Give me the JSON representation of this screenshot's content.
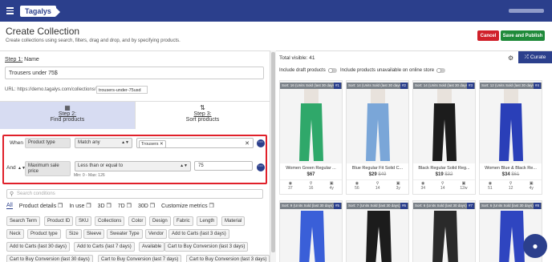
{
  "brand": {
    "logo_text": "Tagalys",
    "primary": "#2b3f8c",
    "danger": "#d0202a",
    "success": "#1f8a3a"
  },
  "header": {
    "title": "Create Collection",
    "subtitle": "Create collections using search, filters, drag and drop, and by specifying products.",
    "cancel_label": "Cancel",
    "save_label": "Save and Publish"
  },
  "step1": {
    "label_prefix": "Step 1:",
    "label": " Name",
    "name_value": "Trousers under 75$",
    "url_label": "URL: https://demo.tagalys.com/collections/",
    "slug_value": "trousers-under-75usd"
  },
  "steps": [
    {
      "title": "Step 2:",
      "sub": "Find products",
      "icon": "grid-icon"
    },
    {
      "title": "Step 3:",
      "sub": "Sort products",
      "icon": "sort-icon"
    }
  ],
  "conditions": {
    "when_label": "When",
    "and_label": "And",
    "c1": {
      "field": "Product type",
      "op": "Match any",
      "tag": "Trousers"
    },
    "c2": {
      "field_line1": "Maximum sale",
      "field_line2": "price",
      "op": "Less than or equal to",
      "value": "75",
      "hint": "Min: 0 - Max: 126"
    }
  },
  "search": {
    "placeholder": "Search conditions"
  },
  "metric_tabs": [
    "All",
    "Product details ❒",
    "In use ❒",
    "3D ❒",
    "7D ❒",
    "30D ❒",
    "Customize metrics ❒"
  ],
  "metric_pills": {
    "r1": [
      "Search Term",
      "Product ID",
      "SKU",
      "Collections",
      "Color",
      "Design",
      "Fabric",
      "Length",
      "Material"
    ],
    "r2": [
      "Neck",
      "Product type",
      "Size",
      "Sleeve",
      "Sweater Type",
      "Vendor",
      "Add to Carts (last 3 days)"
    ],
    "r3": [
      "Add to Carts (last 30 days)",
      "Add to Carts (last 7 days)",
      "Available",
      "Cart to Buy Conversion (last 3 days)"
    ],
    "r4": [
      "Cart to Buy Conversion (last 30 days)",
      "Cart to Buy Conversion (last 7 days)",
      "Cart to Buy Conversion (last 3 days)"
    ]
  },
  "preview": {
    "total_label": "Total visible: 41",
    "curate_label": "Curate",
    "draft_label": "Include draft products",
    "unavailable_label": "Include products unavailable on online store",
    "cards": [
      {
        "banner": "Sort: 16 (Units Sold (last 30 days))",
        "num": "#1",
        "name": "Women Green Regular ...",
        "price": "$67",
        "was": "",
        "s": [
          "37",
          "16",
          "4y"
        ],
        "color": "#2fa86a"
      },
      {
        "banner": "Sort: 14 (Units Sold (last 30 days))",
        "num": "#2",
        "name": "Blue Regular Fit Solid C...",
        "price": "$29",
        "was": "$49",
        "s": [
          "56",
          "14",
          "3y"
        ],
        "color": "#7aa6d8"
      },
      {
        "banner": "Sort: 14 (Units Sold (last 30 days))",
        "num": "#3",
        "name": "Black Regular Solid Reg...",
        "price": "$19",
        "was": "$32",
        "s": [
          "34",
          "14",
          "12w"
        ],
        "color": "#1c1c1c"
      },
      {
        "banner": "Sort: 12 (Units Sold (last 30 days))",
        "num": "#4",
        "name": "Women Blue & Black Re...",
        "price": "$34",
        "was": "$61",
        "s": [
          "51",
          "12",
          "4y"
        ],
        "color": "#2a3fb8"
      }
    ],
    "row2": [
      {
        "banner": "Sort: 9 (Units Sold (last 30 days))",
        "num": "#5",
        "color": "#3a5fd8"
      },
      {
        "banner": "Sort: 7 (Units Sold (last 30 days))",
        "num": "#6",
        "color": "#1c1c1c"
      },
      {
        "banner": "Sort: 6 (Units Sold (last 30 days))",
        "num": "#7",
        "color": "#2a2a2a"
      },
      {
        "banner": "Sort: 6 (Units Sold (last 30 days))",
        "num": "#8",
        "color": "#2f45c0"
      }
    ]
  }
}
